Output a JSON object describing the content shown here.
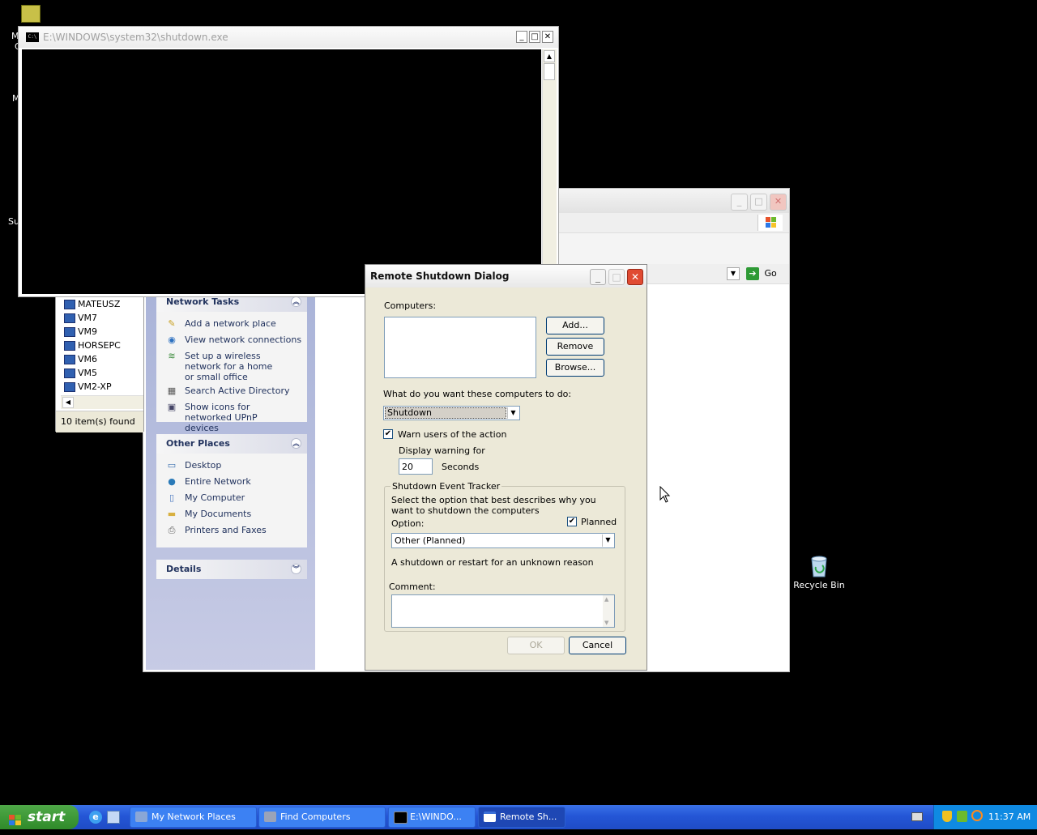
{
  "desktop": {
    "recycle_bin_label": "Recycle Bin",
    "left_edge_fragments": [
      "M",
      "C",
      "M",
      "Su"
    ]
  },
  "console_window": {
    "title": "E:\\WINDOWS\\system32\\shutdown.exe",
    "icon_text": "C:\\"
  },
  "find_window": {
    "computers": [
      "MATEUSZ",
      "VM7",
      "VM9",
      "HORSEPC",
      "VM6",
      "VM5",
      "VM2-XP"
    ],
    "status": "10 item(s) found"
  },
  "network_window": {
    "go_label": "Go",
    "network_tasks": {
      "title": "Network Tasks",
      "items": [
        "Add a network place",
        "View network connections",
        "Set up a wireless network for a home or small office",
        "Search Active Directory",
        "Show icons for networked UPnP devices"
      ]
    },
    "other_places": {
      "title": "Other Places",
      "items": [
        "Desktop",
        "Entire Network",
        "My Computer",
        "My Documents",
        "Printers and Faxes"
      ]
    },
    "details": {
      "title": "Details"
    }
  },
  "dialog": {
    "title": "Remote Shutdown Dialog",
    "computers_label": "Computers:",
    "add_button": "Add...",
    "remove_button": "Remove",
    "browse_button": "Browse...",
    "action_question": "What do you want these computers to do:",
    "action_value": "Shutdown",
    "warn_label": "Warn users of the action",
    "warn_checked": true,
    "display_warning_label": "Display warning for",
    "seconds_value": "20",
    "seconds_label": "Seconds",
    "tracker_title": "Shutdown Event Tracker",
    "tracker_description": "Select the option that best describes why you want to shutdown the computers",
    "planned_label": "Planned",
    "planned_checked": true,
    "option_label": "Option:",
    "option_value": "Other (Planned)",
    "option_description": "A shutdown or restart for an unknown reason",
    "comment_label": "Comment:",
    "ok_button": "OK",
    "cancel_button": "Cancel"
  },
  "taskbar": {
    "start_label": "start",
    "tasks": [
      "My Network Places",
      "Find Computers",
      "E:\\WINDO...",
      "Remote Sh..."
    ],
    "clock": "11:37 AM"
  }
}
